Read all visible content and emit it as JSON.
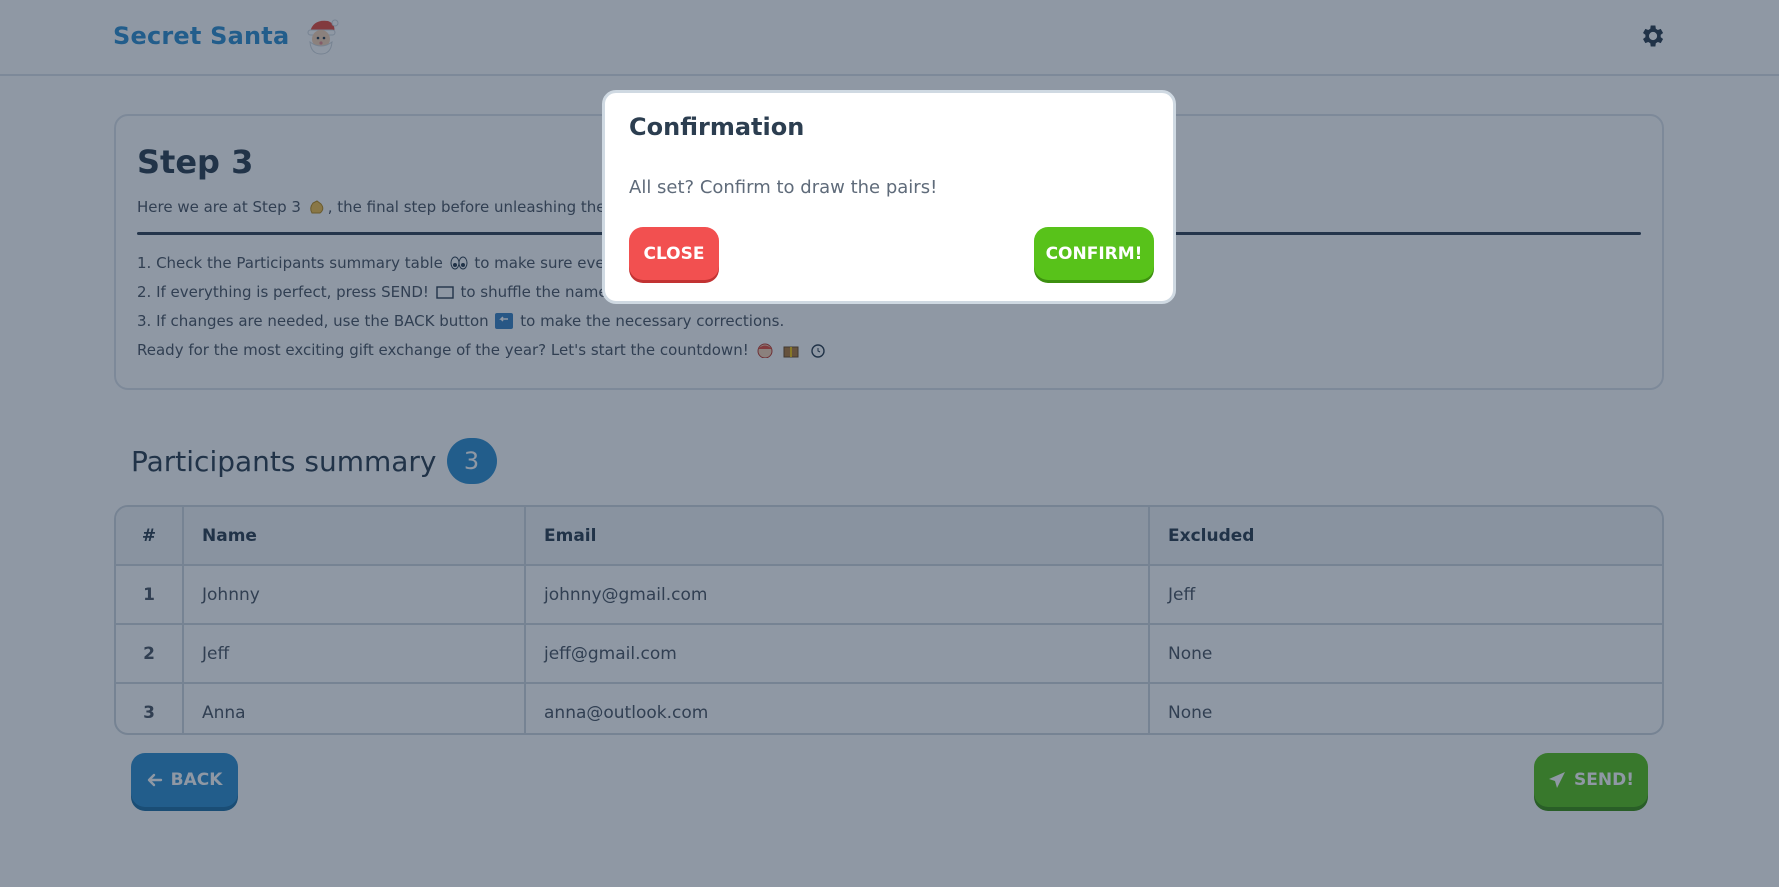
{
  "header": {
    "brand_title": "Secret Santa",
    "brand_icon": "santa-icon",
    "settings_icon": "gear-icon"
  },
  "step": {
    "title": "Step 3",
    "intro_before": "Here we are at Step 3",
    "intro_after": ", the final step before unleashing the pa",
    "line1_before": "1. Check the Participants summary table",
    "line1_after": "to make sure everyt",
    "line2_before": "2. If everything is perfect, press SEND!",
    "line2_after": "to shuffle the names a",
    "line3_before": "3. If changes are needed, use the BACK button",
    "line3_after": "to make the necessary corrections.",
    "line4": "Ready for the most exciting gift exchange of the year? Let's start the countdown!"
  },
  "participants": {
    "title": "Participants summary",
    "count": "3",
    "columns": [
      "#",
      "Name",
      "Email",
      "Excluded"
    ],
    "rows": [
      {
        "num": "1",
        "name": "Johnny",
        "email": "johnny@gmail.com",
        "excluded": "Jeff"
      },
      {
        "num": "2",
        "name": "Jeff",
        "email": "jeff@gmail.com",
        "excluded": "None"
      },
      {
        "num": "3",
        "name": "Anna",
        "email": "anna@outlook.com",
        "excluded": "None"
      }
    ]
  },
  "actions": {
    "back_label": "BACK",
    "send_label": "SEND!"
  },
  "modal": {
    "title": "Confirmation",
    "message": "All set? Confirm to draw the pairs!",
    "close_label": "CLOSE",
    "confirm_label": "CONFIRM!"
  },
  "colors": {
    "brand": "#2e8fd0",
    "success": "#58c21a",
    "danger": "#f25050",
    "overlay": "rgba(20, 40, 65, 0.48)"
  }
}
